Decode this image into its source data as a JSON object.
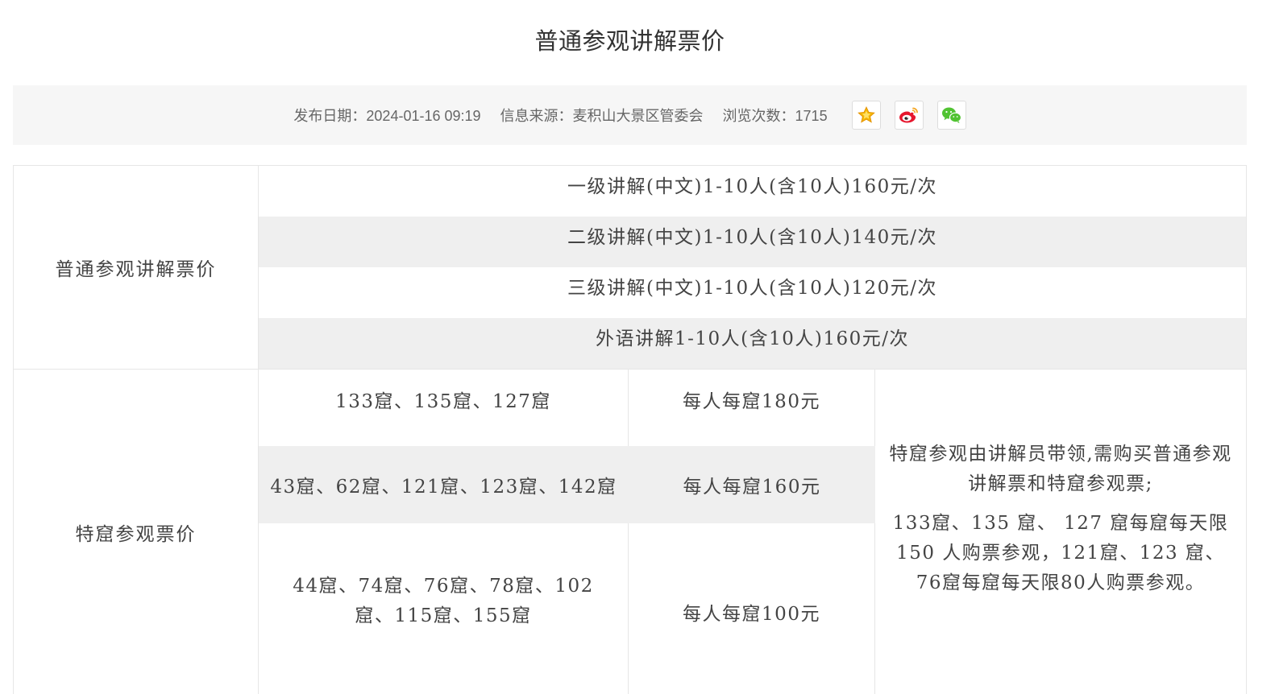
{
  "page": {
    "title": "普通参观讲解票价"
  },
  "meta": {
    "publish_date_label": "发布日期：",
    "publish_date": "2024-01-16 09:19",
    "source_label": "信息来源：",
    "source": "麦积山大景区管委会",
    "views_label": "浏览次数：",
    "views": "1715",
    "share_icons": [
      "favorite-star-icon",
      "weibo-icon",
      "wechat-icon"
    ],
    "colors": {
      "star": "#f2a71d",
      "weibo": "#e6162d",
      "wechat": "#51c332"
    }
  },
  "pricing": {
    "guide_section": {
      "header": "普通参观讲解票价",
      "rows": [
        "一级讲解(中文)1-10人(含10人)160元/次",
        "二级讲解(中文)1-10人(含10人)140元/次",
        "三级讲解(中文)1-10人(含10人)120元/次",
        "外语讲解1-10人(含10人)160元/次"
      ]
    },
    "special_section": {
      "header": "特窟参观票价",
      "rows": [
        {
          "caves": "133窟、135窟、127窟",
          "price": "每人每窟180元"
        },
        {
          "caves": "43窟、62窟、121窟、123窟、142窟",
          "price": "每人每窟160元"
        },
        {
          "caves": "44窟、74窟、76窟、78窟、102窟、115窟、155窟",
          "price": "每人每窟100元"
        }
      ],
      "notes": [
        "特窟参观由讲解员带领,需购买普通参观讲解票和特窟参观票;",
        "133窟、135 窟、 127 窟每窟每天限150 人购票参观，121窟、123 窟、76窟每窟每天限80人购票参观。"
      ]
    }
  }
}
